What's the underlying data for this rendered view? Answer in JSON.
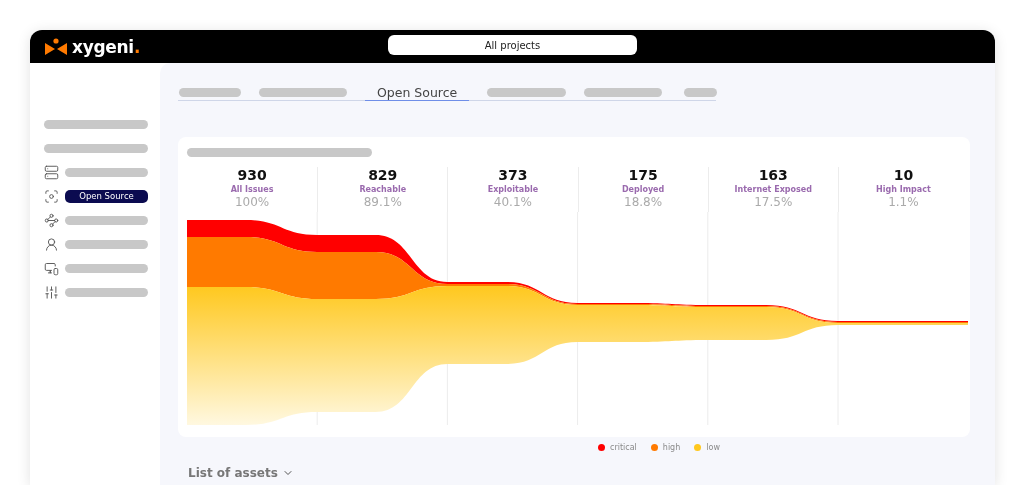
{
  "header": {
    "logo": {
      "text": "xygeni",
      "dot": "."
    },
    "project_selector": "All projects"
  },
  "sidebar": {
    "items": [
      {
        "kind": "bar",
        "selected": false
      },
      {
        "kind": "bar",
        "selected": false
      },
      {
        "kind": "icon-bar",
        "selected": false
      },
      {
        "kind": "icon-label",
        "label": "Open Source",
        "selected": true
      },
      {
        "kind": "icon-bar",
        "selected": false
      },
      {
        "kind": "icon-bar",
        "selected": false
      },
      {
        "kind": "icon-bar",
        "selected": false
      },
      {
        "kind": "icon-bar",
        "selected": false
      }
    ]
  },
  "tabs": [
    {
      "kind": "bar",
      "selected": false
    },
    {
      "kind": "bar",
      "selected": false
    },
    {
      "kind": "label",
      "label": "Open Source",
      "selected": true
    },
    {
      "kind": "bar",
      "selected": false
    },
    {
      "kind": "bar",
      "selected": false
    },
    {
      "kind": "bar",
      "selected": false
    }
  ],
  "funnel": {
    "stages": [
      {
        "count": "930",
        "label": "All Issues",
        "percent": "100%"
      },
      {
        "count": "829",
        "label": "Reachable",
        "percent": "89.1%"
      },
      {
        "count": "373",
        "label": "Exploitable",
        "percent": "40.1%"
      },
      {
        "count": "175",
        "label": "Deployed",
        "percent": "18.8%"
      },
      {
        "count": "163",
        "label": "Internet Exposed",
        "percent": "17.5%"
      },
      {
        "count": "10",
        "label": "High Impact",
        "percent": "1.1%"
      }
    ],
    "legend": [
      {
        "label": "critical",
        "color": "#ff0000"
      },
      {
        "label": "high",
        "color": "#ff7a00"
      },
      {
        "label": "low",
        "color": "#ffc81e"
      }
    ]
  },
  "section_title": "List of assets"
}
